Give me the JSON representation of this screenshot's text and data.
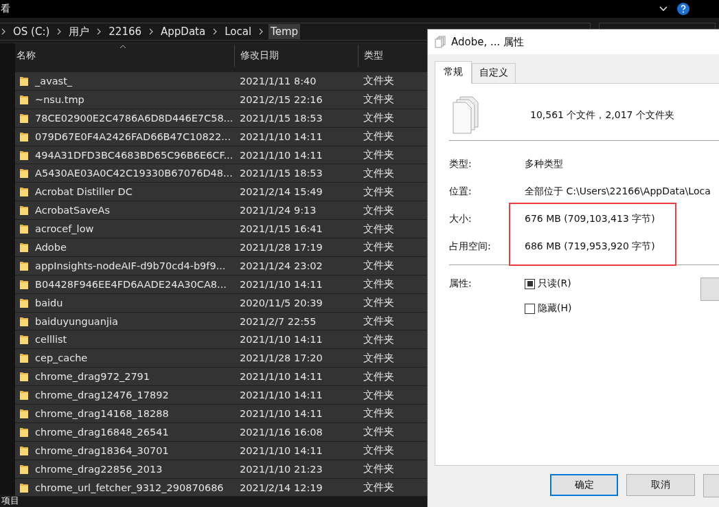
{
  "window": {
    "title": "看"
  },
  "address": {
    "crumbs": [
      {
        "label": "OS (C:)",
        "selected": false
      },
      {
        "label": "用户",
        "selected": false
      },
      {
        "label": "22166",
        "selected": false
      },
      {
        "label": "AppData",
        "selected": false
      },
      {
        "label": "Local",
        "selected": false
      },
      {
        "label": "Temp",
        "selected": true
      }
    ]
  },
  "table": {
    "columns": [
      "名称",
      "修改日期",
      "类型"
    ],
    "rows": [
      {
        "name": "_avast_",
        "date": "2021/1/11 8:40",
        "type": "文件夹",
        "selected": true
      },
      {
        "name": "~nsu.tmp",
        "date": "2021/2/15 22:16",
        "type": "文件夹",
        "selected": true
      },
      {
        "name": "78CE02900E2C4786A6D8D446E7C58...",
        "date": "2021/1/15 18:53",
        "type": "文件夹",
        "selected": true
      },
      {
        "name": "079D67E0F4A2426FAD66B47C10822...",
        "date": "2021/1/10 14:11",
        "type": "文件夹",
        "selected": true
      },
      {
        "name": "494A31DFD3BC4683BD65C96B6E6CF...",
        "date": "2021/1/10 14:11",
        "type": "文件夹",
        "selected": true
      },
      {
        "name": "A5430AE03A0C42C19330B67076D48...",
        "date": "2021/1/15 18:53",
        "type": "文件夹",
        "selected": true
      },
      {
        "name": "Acrobat Distiller DC",
        "date": "2021/2/14 15:49",
        "type": "文件夹",
        "selected": true
      },
      {
        "name": "AcrobatSaveAs",
        "date": "2021/1/24 9:13",
        "type": "文件夹",
        "selected": true
      },
      {
        "name": "acrocef_low",
        "date": "2021/1/15 16:41",
        "type": "文件夹",
        "selected": true
      },
      {
        "name": "Adobe",
        "date": "2021/1/28 17:19",
        "type": "文件夹",
        "selected": true
      },
      {
        "name": "appInsights-nodeAIF-d9b70cd4-b9f9...",
        "date": "2021/1/24 23:02",
        "type": "文件夹",
        "selected": true
      },
      {
        "name": "B04428F946EE4FD6AADE24A30CA8...",
        "date": "2021/1/10 14:11",
        "type": "文件夹",
        "selected": true
      },
      {
        "name": "baidu",
        "date": "2020/11/5 20:39",
        "type": "文件夹",
        "selected": true
      },
      {
        "name": "baiduyunguanjia",
        "date": "2021/2/7 22:55",
        "type": "文件夹",
        "selected": true
      },
      {
        "name": "celllist",
        "date": "2021/1/10 14:11",
        "type": "文件夹",
        "selected": true
      },
      {
        "name": "cep_cache",
        "date": "2021/1/28 17:20",
        "type": "文件夹",
        "selected": true
      },
      {
        "name": "chrome_drag972_2791",
        "date": "2021/1/10 14:11",
        "type": "文件夹",
        "selected": true
      },
      {
        "name": "chrome_drag12476_17892",
        "date": "2021/1/10 14:11",
        "type": "文件夹",
        "selected": true
      },
      {
        "name": "chrome_drag14168_18288",
        "date": "2021/1/10 14:11",
        "type": "文件夹",
        "selected": true
      },
      {
        "name": "chrome_drag16848_26541",
        "date": "2021/1/16 16:08",
        "type": "文件夹",
        "selected": true
      },
      {
        "name": "chrome_drag18364_30701",
        "date": "2021/1/10 14:11",
        "type": "文件夹",
        "selected": true
      },
      {
        "name": "chrome_drag22856_2013",
        "date": "2021/1/10 21:23",
        "type": "文件夹",
        "selected": true
      },
      {
        "name": "chrome_url_fetcher_9312_290870686",
        "date": "2021/2/14 12:19",
        "type": "文件夹",
        "selected": true
      }
    ]
  },
  "status_bar": {
    "text": "项目"
  },
  "dialog": {
    "title": "Adobe, ... 属性",
    "tabs": [
      {
        "label": "常规",
        "selected": true
      },
      {
        "label": "自定义",
        "selected": false
      }
    ],
    "summary": "10,561 个文件，2,017 个文件夹",
    "properties": [
      {
        "label": "类型:",
        "value": "多种类型",
        "highlighted": false
      },
      {
        "label": "位置:",
        "value": "全部位于 C:\\Users\\22166\\AppData\\Loca",
        "highlighted": false
      },
      {
        "label": "大小:",
        "value": "676 MB (709,103,413 字节)",
        "highlighted": true
      },
      {
        "label": "占用空间:",
        "value": "686 MB (719,953,920 字节)",
        "highlighted": true
      }
    ],
    "attributes_label": "属性:",
    "attributes": [
      {
        "label": "只读(R)",
        "checked": true
      },
      {
        "label": "隐藏(H)",
        "checked": false
      }
    ],
    "buttons": [
      {
        "label": "确定",
        "default": true
      },
      {
        "label": "取消",
        "default": false
      }
    ]
  }
}
